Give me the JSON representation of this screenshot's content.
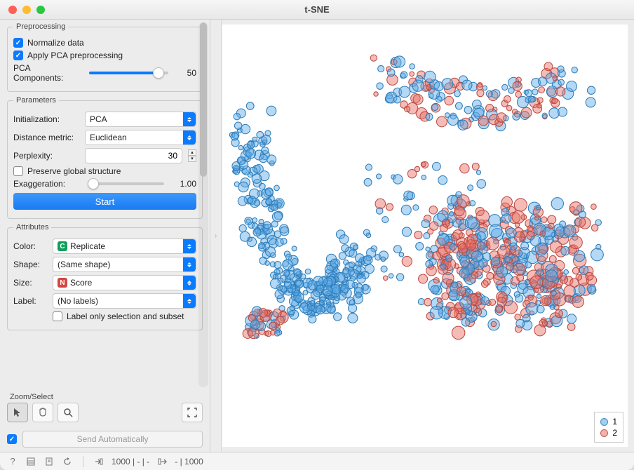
{
  "window": {
    "title": "t-SNE"
  },
  "preprocessing": {
    "legend": "Preprocessing",
    "normalize_label": "Normalize data",
    "normalize_checked": true,
    "pca_label": "Apply PCA preprocessing",
    "pca_checked": true,
    "pca_components_label": "PCA Components:",
    "pca_components_value": "50",
    "pca_slider_percent": 88
  },
  "parameters": {
    "legend": "Parameters",
    "initialization_label": "Initialization:",
    "initialization_value": "PCA",
    "distance_label": "Distance metric:",
    "distance_value": "Euclidean",
    "perplexity_label": "Perplexity:",
    "perplexity_value": "30",
    "preserve_label": "Preserve global structure",
    "preserve_checked": false,
    "exaggeration_label": "Exaggeration:",
    "exaggeration_value": "1.00",
    "exaggeration_slider_percent": 6,
    "start_label": "Start"
  },
  "attributes": {
    "legend": "Attributes",
    "color_label": "Color:",
    "color_value": "Replicate",
    "color_badge": "C",
    "shape_label": "Shape:",
    "shape_value": "(Same shape)",
    "size_label": "Size:",
    "size_value": "Score",
    "size_badge": "N",
    "label_label": "Label:",
    "label_value": "(No labels)",
    "truncated_checkbox_label": "Label only selection and subset"
  },
  "zoom": {
    "section_label": "Zoom/Select",
    "arrow_tool": "select",
    "pan_tool": "pan",
    "zoom_tool": "zoom",
    "fit_tool": "fit"
  },
  "send": {
    "auto_checked": true,
    "button_label": "Send Automatically"
  },
  "legend": {
    "items": [
      {
        "label": "1",
        "cls": "sw1"
      },
      {
        "label": "2",
        "cls": "sw2"
      }
    ]
  },
  "status": {
    "in_text": "1000 | - | -",
    "out_text": "- | 1000"
  },
  "chart_data": {
    "type": "scatter",
    "title": "",
    "xlabel": "",
    "ylabel": "",
    "xlim": [
      0,
      550
    ],
    "ylim": [
      0,
      550
    ],
    "note": "t-SNE 2D embedding colored by Replicate (1=blue, 2=red), point size by Score. Two main clusters: a large curved blue-dominant cluster on the left/lower-left, and a dense mixed red+blue cluster on the right/center-right, plus a sparse upper arc.",
    "series": [
      {
        "name": "1",
        "color": "#5aa9e6",
        "approx_count": 600
      },
      {
        "name": "2",
        "color": "#e86a5f",
        "approx_count": 400
      }
    ]
  }
}
